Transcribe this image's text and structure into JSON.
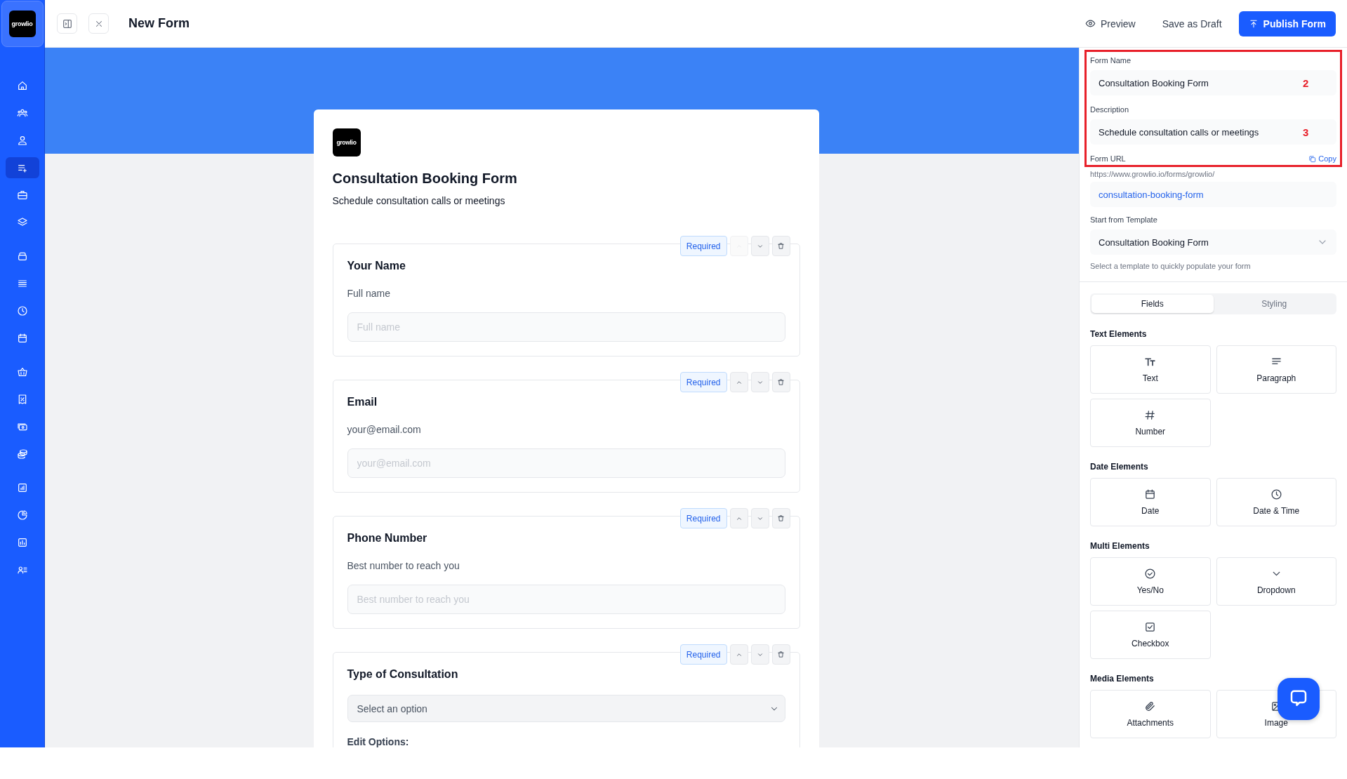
{
  "sidebar": {
    "logo": "growlio",
    "items": [
      {
        "selected": false
      },
      {
        "selected": false
      },
      {
        "selected": false
      },
      {
        "selected": true
      },
      {
        "selected": false
      },
      {
        "selected": false
      },
      {
        "selected": false
      },
      {
        "selected": false
      },
      {
        "selected": false
      },
      {
        "selected": false
      },
      {
        "selected": false
      },
      {
        "selected": false
      },
      {
        "selected": false
      },
      {
        "selected": false
      },
      {
        "selected": false
      },
      {
        "selected": false
      },
      {
        "selected": false
      },
      {
        "selected": false
      }
    ]
  },
  "header": {
    "title": "New Form",
    "actions": [
      {
        "kind": "preview",
        "label": "Preview"
      },
      {
        "kind": "draft",
        "label": "Save as Draft"
      },
      {
        "kind": "publish",
        "label": "Publish Form"
      }
    ]
  },
  "form": {
    "logo": "growlio",
    "title": "Consultation Booking Form",
    "description": "Schedule consultation calls or meetings",
    "fields": [
      {
        "kind": "text",
        "label": "Your Name",
        "help": "Full name",
        "placeholder": "Full name",
        "badge": "Required",
        "up_disabled": true
      },
      {
        "kind": "text",
        "label": "Email",
        "help": "your@email.com",
        "placeholder": "your@email.com",
        "badge": "Required",
        "up_disabled": false
      },
      {
        "kind": "text",
        "label": "Phone Number",
        "help": "Best number to reach you",
        "placeholder": "Best number to reach you",
        "badge": "Required",
        "up_disabled": false
      },
      {
        "kind": "select",
        "label": "Type of Consultation",
        "value": "Select an option",
        "extra": "Edit Options:",
        "badge": "Required",
        "up_disabled": false
      }
    ]
  },
  "settings": {
    "form_name": {
      "label": "Form Name",
      "value": "Consultation Booking Form",
      "annotation": "2"
    },
    "description": {
      "label": "Description",
      "value": "Schedule consultation calls or meetings",
      "annotation": "3"
    },
    "form_url": {
      "label": "Form URL",
      "copy": "Copy",
      "prefix": "https://www.growlio.io/forms/growlio/",
      "slug": "consultation-booking-form"
    },
    "template": {
      "label": "Start from Template",
      "value": "Consultation Booking Form",
      "hint": "Select a template to quickly populate your form"
    },
    "tabs": [
      {
        "label": "Fields",
        "selected": true
      },
      {
        "label": "Styling",
        "selected": false
      }
    ],
    "groups": [
      {
        "title": "Text Elements",
        "items": [
          {
            "kind": "text",
            "label": "Text"
          },
          {
            "kind": "paragraph",
            "label": "Paragraph"
          },
          {
            "kind": "number",
            "label": "Number"
          }
        ]
      },
      {
        "title": "Date Elements",
        "items": [
          {
            "kind": "date",
            "label": "Date"
          },
          {
            "kind": "datetime",
            "label": "Date & Time"
          }
        ]
      },
      {
        "title": "Multi Elements",
        "items": [
          {
            "kind": "yesno",
            "label": "Yes/No"
          },
          {
            "kind": "dropdown",
            "label": "Dropdown"
          },
          {
            "kind": "checkbox",
            "label": "Checkbox"
          }
        ]
      },
      {
        "title": "Media Elements",
        "items": [
          {
            "kind": "attachment",
            "label": "Attachments"
          },
          {
            "kind": "image",
            "label": "Image"
          }
        ]
      }
    ]
  }
}
